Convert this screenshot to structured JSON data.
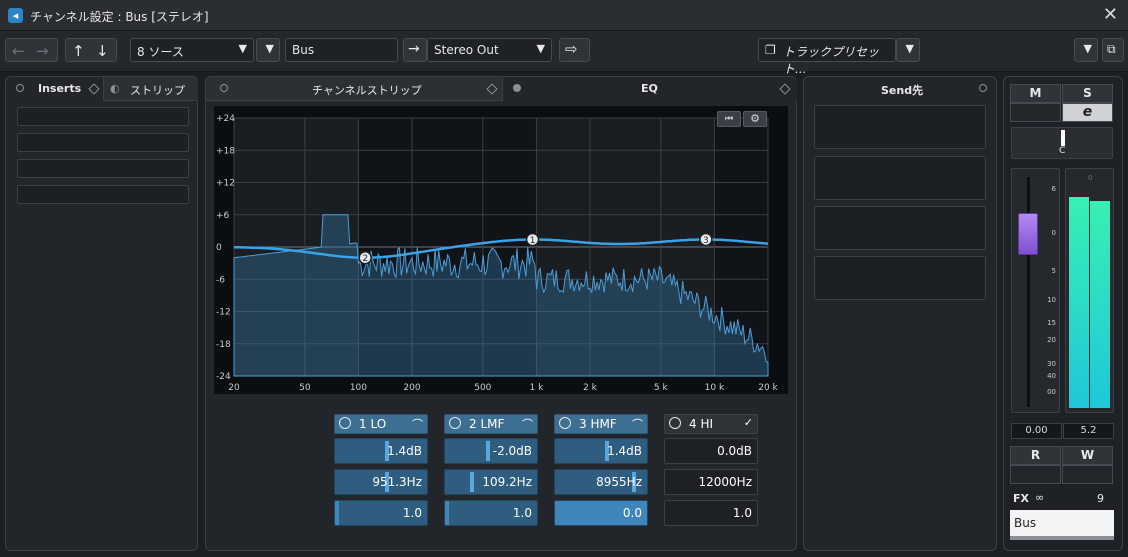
{
  "window": {
    "title": "チャンネル設定 : Bus [ステレオ]"
  },
  "toolbar": {
    "sources": "8 ソース",
    "channel_name": "Bus",
    "output": "Stereo Out",
    "track_preset": "トラックプリセット..."
  },
  "left_panel": {
    "tab_inserts": "Inserts",
    "tab_strip": "ストリップ"
  },
  "center_panel": {
    "tab_channel_strip": "チャンネルストリップ",
    "tab_eq": "EQ"
  },
  "eq": {
    "y_labels": [
      "+24",
      "+18",
      "+12",
      "+6",
      "0",
      "-6",
      "-12",
      "-18",
      "-24"
    ],
    "x_labels": [
      "20",
      "50",
      "100",
      "200",
      "500",
      "1 k",
      "2 k",
      "5 k",
      "10 k",
      "20 k"
    ],
    "bands": [
      {
        "name": "1 LO",
        "shape": "⌒",
        "on": true,
        "gain": "1.4dB",
        "freq": "951.3Hz",
        "q": "1.0",
        "gain_frac": 0.55,
        "freq_frac": 0.55,
        "q_frac": 0.02
      },
      {
        "name": "2 LMF",
        "shape": "⌒",
        "on": true,
        "gain": "-2.0dB",
        "freq": "109.2Hz",
        "q": "1.0",
        "gain_frac": 0.45,
        "freq_frac": 0.28,
        "q_frac": 0.02
      },
      {
        "name": "3 HMF",
        "shape": "⌒",
        "on": true,
        "gain": "1.4dB",
        "freq": "8955Hz",
        "q": "0.0",
        "gain_frac": 0.55,
        "freq_frac": 0.85,
        "q_frac": 1.0
      },
      {
        "name": "4 HI",
        "shape": "✓",
        "on": false,
        "gain": "0.0dB",
        "freq": "12000Hz",
        "q": "1.0"
      }
    ],
    "nodes": [
      {
        "label": "1",
        "freq_hz": 951.3,
        "gain_db": 1.4
      },
      {
        "label": "2",
        "freq_hz": 109.2,
        "gain_db": -2.0
      },
      {
        "label": "3",
        "freq_hz": 8955,
        "gain_db": 1.4
      }
    ]
  },
  "send_panel": {
    "title": "Send先"
  },
  "right_strip": {
    "mute": "M",
    "solo": "S",
    "edit": "e",
    "pan_label": "C",
    "fader_scale": [
      "6",
      "0",
      "5",
      "10",
      "15",
      "20",
      "30",
      "40",
      "00"
    ],
    "meter_scale_top": "0",
    "fader_value": "0.00",
    "meter_value": "5.2",
    "read": "R",
    "write": "W",
    "fx_label": "FX",
    "fx_count": "9",
    "channel_name": "Bus"
  },
  "colors": {
    "accent": "#3f86bb",
    "curve": "#3aa2e6",
    "meter": "#2ef0a8"
  }
}
